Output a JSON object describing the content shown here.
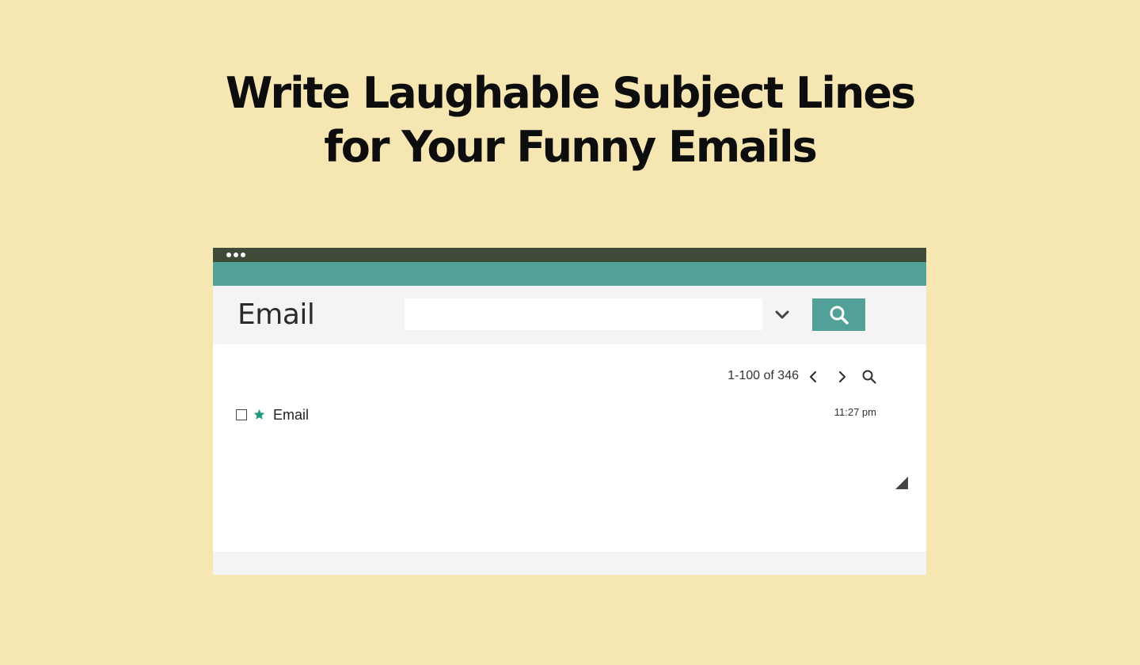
{
  "headline": {
    "line1": "Write Laughable Subject Lines",
    "line2": "for Your Funny Emails"
  },
  "window": {
    "titlebar_dots": 3,
    "colors": {
      "titlebar": "#3e4b38",
      "accent": "#52a198",
      "toolbar": "#f4f4f4",
      "background": "#f5e6b2",
      "star": "#1f9a7a"
    }
  },
  "toolbar": {
    "app_title": "Email",
    "search": {
      "value": "",
      "placeholder": ""
    },
    "dropdown_icon": "chevron-down-icon",
    "search_button_icon": "search-icon"
  },
  "pager": {
    "range_text": "1-100 of 346",
    "prev_icon": "chevron-left-icon",
    "next_icon": "chevron-right-icon",
    "search_icon": "search-icon"
  },
  "messages": [
    {
      "checked": false,
      "starred": true,
      "subject": "Email",
      "time": "11:27 pm"
    }
  ],
  "resize_icon": "resize-handle-icon"
}
